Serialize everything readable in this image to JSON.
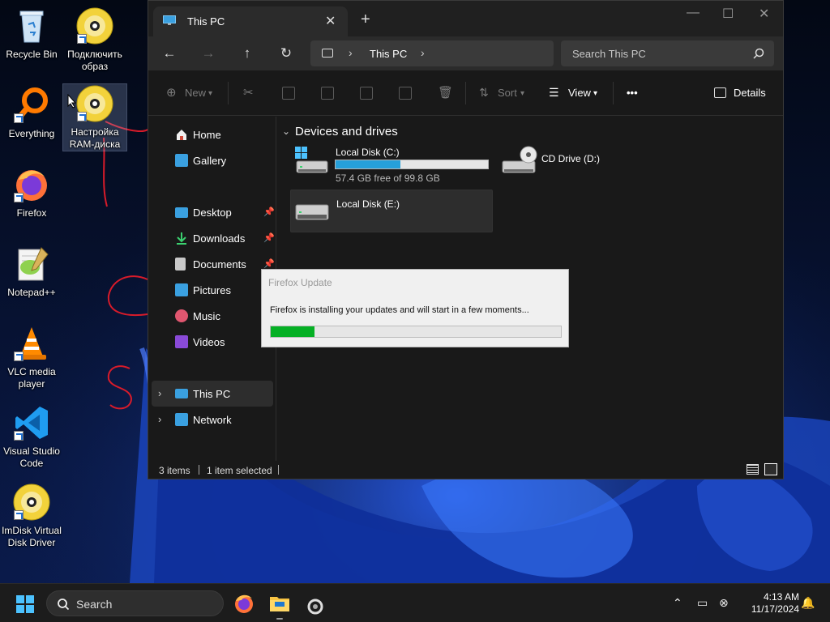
{
  "desktop": {
    "icons": [
      {
        "label": "Recycle Bin"
      },
      {
        "label": "Подключить образ"
      },
      {
        "label": "Everything"
      },
      {
        "label": "Настройка RAM-диска"
      },
      {
        "label": "Firefox"
      },
      {
        "label": "Notepad++"
      },
      {
        "label": "VLC media player"
      },
      {
        "label": "Visual Studio Code"
      },
      {
        "label": "ImDisk Virtual Disk Driver"
      }
    ]
  },
  "explorer": {
    "tab_title": "This PC",
    "new_tab": "+",
    "close_tab": "✕",
    "window_controls": {
      "minimize": "—",
      "maximize": "☐",
      "close": "✕"
    },
    "nav": {
      "back": "←",
      "forward": "→",
      "up": "↑",
      "refresh": "↻"
    },
    "address": {
      "crumb": "This PC"
    },
    "search": {
      "placeholder": "Search This PC"
    },
    "toolbar": {
      "new": "New",
      "sort": "Sort",
      "view": "View",
      "more": "•••",
      "details": "Details"
    },
    "sidebar": {
      "items": [
        {
          "label": "Home",
          "icon": "home-icon"
        },
        {
          "label": "Gallery",
          "icon": "gallery-icon"
        },
        {
          "label": "Desktop",
          "icon": "desktop-icon",
          "pinned": true
        },
        {
          "label": "Downloads",
          "icon": "downloads-icon",
          "pinned": true
        },
        {
          "label": "Documents",
          "icon": "documents-icon",
          "pinned": true
        },
        {
          "label": "Pictures",
          "icon": "pictures-icon"
        },
        {
          "label": "Music",
          "icon": "music-icon"
        },
        {
          "label": "Videos",
          "icon": "videos-icon"
        },
        {
          "label": "This PC",
          "icon": "this-pc-icon"
        },
        {
          "label": "Network",
          "icon": "network-icon"
        }
      ]
    },
    "content": {
      "group_title": "Devices and drives",
      "drives": [
        {
          "name": "Local Disk (C:)",
          "free": "57.4 GB free of 99.8 GB",
          "used_fraction": 0.425
        },
        {
          "name": "CD Drive (D:)"
        },
        {
          "name": "Local Disk (E:)"
        }
      ]
    },
    "status": {
      "items": "3 items",
      "selected": "1 item selected"
    }
  },
  "firefox_update": {
    "title": "Firefox Update",
    "message": "Firefox is installing your updates and will start in a few moments...",
    "progress": 0.15
  },
  "taskbar": {
    "search_label": "Search",
    "time": "4:13 AM",
    "date": "11/17/2024"
  },
  "colors": {
    "accent": "#26a0da",
    "progress_green": "#06b025",
    "start_blue": "#4cc2ff"
  }
}
